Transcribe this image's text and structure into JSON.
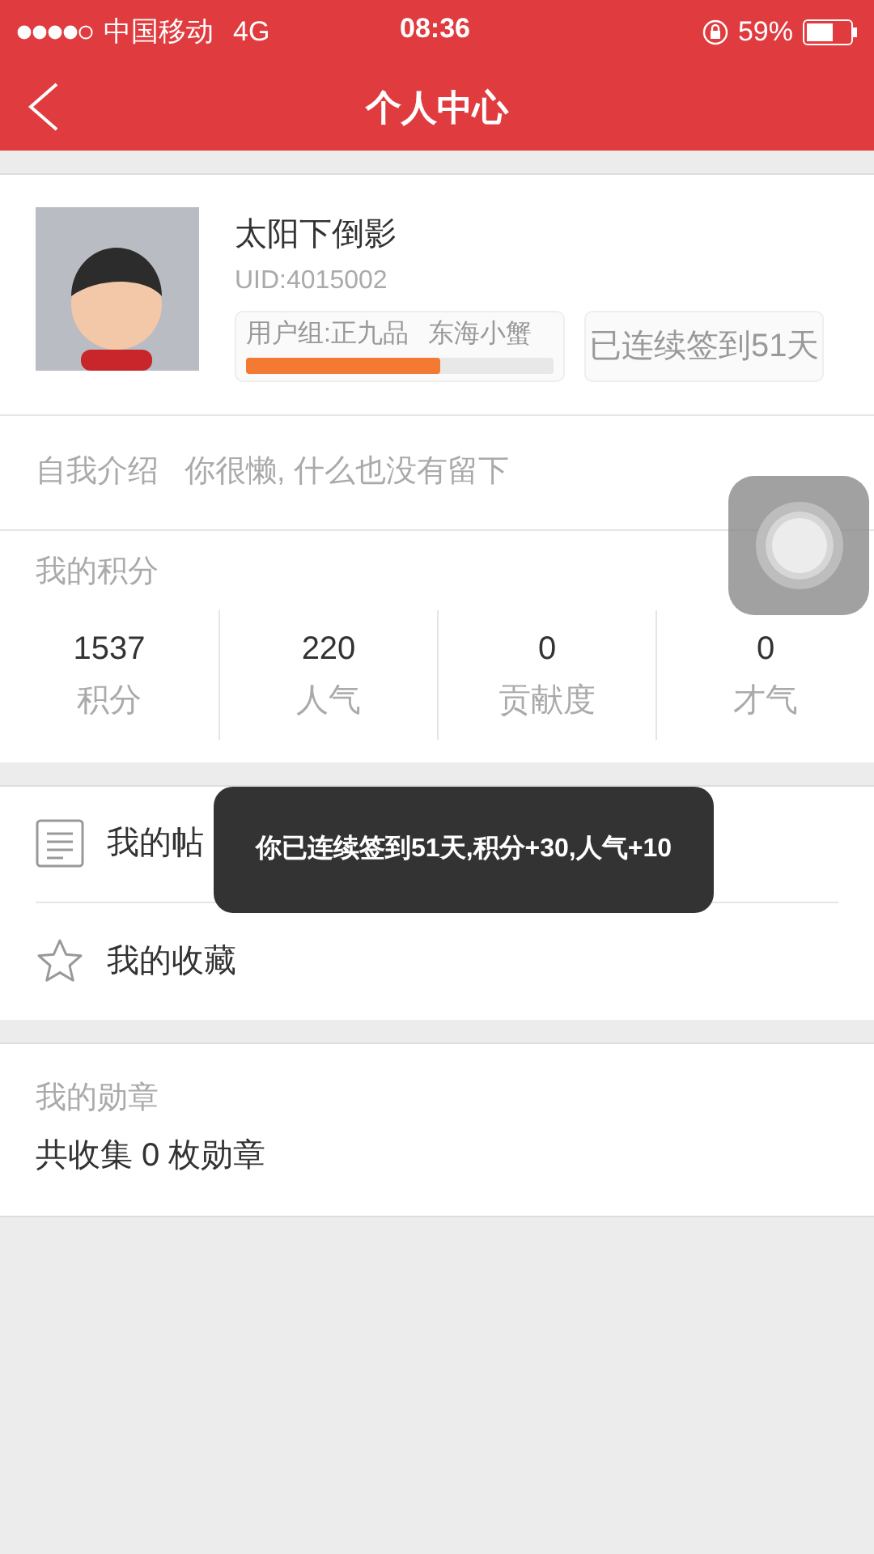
{
  "status_bar": {
    "carrier": "中国移动",
    "network": "4G",
    "time": "08:36",
    "battery": "59%"
  },
  "nav": {
    "title": "个人中心"
  },
  "profile": {
    "name": "太阳下倒影",
    "uid": "UID:4015002",
    "group": "用户组:正九品",
    "rank": "东海小蟹",
    "level": 0.63,
    "checkin": "已连续签到51天"
  },
  "intro": {
    "label": "自我介绍",
    "value": "你很懒, 什么也没有留下"
  },
  "points": {
    "title": "我的积分",
    "stats": [
      {
        "value": "1537",
        "label": "积分"
      },
      {
        "value": "220",
        "label": "人气"
      },
      {
        "value": "0",
        "label": "贡献度"
      },
      {
        "value": "0",
        "label": "才气"
      }
    ]
  },
  "menu": [
    {
      "kind": "posts",
      "label": "我的帖"
    },
    {
      "kind": "favorites",
      "label": "我的收藏"
    }
  ],
  "medals": {
    "title": "我的勋章",
    "summary": "共收集 0 枚勋章"
  },
  "toast": "你已连续签到51天,积分+30,人气+10"
}
